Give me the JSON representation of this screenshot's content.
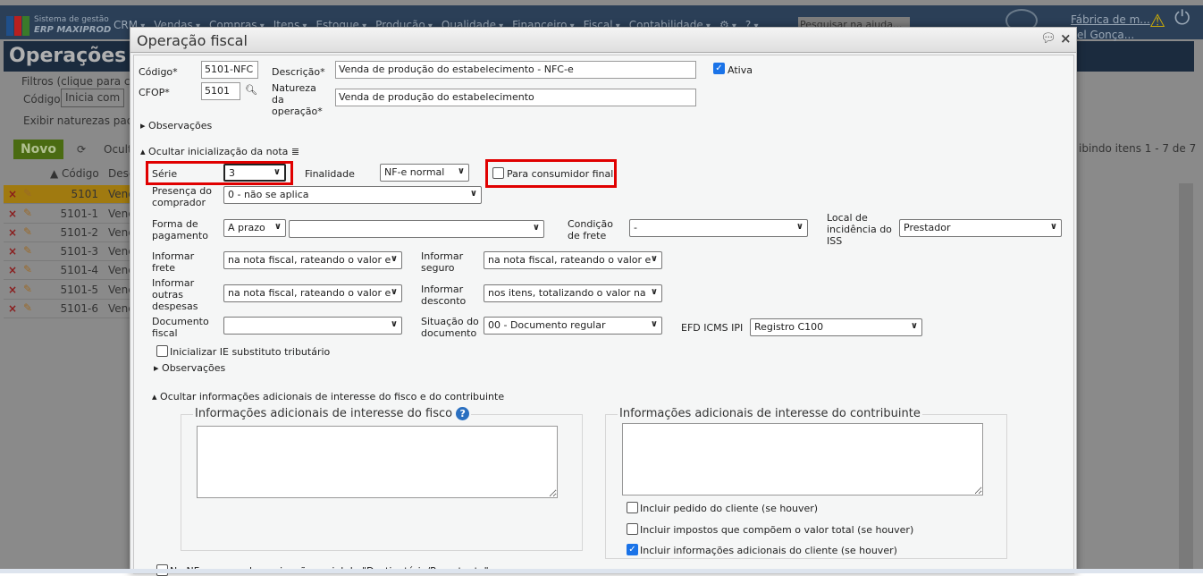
{
  "app": {
    "brand_line1": "Sistema de gestão",
    "brand_line2": "ERP MAXIPROD",
    "search_placeholder": "Pesquisar na ajuda...",
    "company": "Fábrica de m...",
    "user": "el Gonça...",
    "menu": [
      "CRM",
      "Vendas",
      "Compras",
      "Itens",
      "Estoque",
      "Produção",
      "Qualidade",
      "Financeiro",
      "Fiscal",
      "Contabilidade"
    ]
  },
  "background": {
    "page_title": "Operações f",
    "filters_label": "Filtros (clique para cor",
    "filter_field": "Código",
    "filter_op": "Inicia com",
    "show_label": "Exibir naturezas padrã",
    "new_button": "Novo",
    "hide_label": "Ocult",
    "paging": "ibindo itens 1 - 7 de 7",
    "col_code": "Código",
    "col_desc": "Desc",
    "rows": [
      {
        "code": "5101",
        "desc": "Venc"
      },
      {
        "code": "5101-1",
        "desc": "Venc"
      },
      {
        "code": "5101-2",
        "desc": "Venc"
      },
      {
        "code": "5101-3",
        "desc": "Venc"
      },
      {
        "code": "5101-4",
        "desc": "Venc"
      },
      {
        "code": "5101-5",
        "desc": "Venc"
      },
      {
        "code": "5101-6",
        "desc": "Venc"
      }
    ]
  },
  "modal": {
    "title": "Operação fiscal",
    "codigo_label": "Código*",
    "codigo": "5101-NFC",
    "descricao_label": "Descrição*",
    "descricao": "Venda de produção do estabelecimento - NFC-e",
    "ativa_label": "Ativa",
    "cfop_label": "CFOP*",
    "cfop": "5101",
    "natureza_label": "Natureza da operação*",
    "natureza": "Venda de produção do estabelecimento",
    "observacoes": "Observações",
    "ocultar_init": "Ocultar inicialização da nota",
    "serie_label": "Série",
    "serie": "3",
    "finalidade_label": "Finalidade",
    "finalidade": "NF-e normal",
    "consumidor_label": "Para consumidor final",
    "presenca_label": "Presença do comprador",
    "presenca": "0 - não se aplica",
    "forma_label": "Forma de pagamento",
    "forma": "A prazo",
    "forma2": "",
    "condicao_label": "Condição de frete",
    "condicao": "-",
    "local_iss_label": "Local de incidência do ISS",
    "local_iss": "Prestador",
    "frete_label": "Informar frete",
    "frete": "na nota fiscal, rateando o valor e",
    "seguro_label": "Informar seguro",
    "seguro": "na nota fiscal, rateando o valor e",
    "despesas_label": "Informar outras despesas",
    "despesas": "na nota fiscal, rateando o valor e",
    "desconto_label": "Informar desconto",
    "desconto": "nos itens, totalizando o valor na",
    "documento_label": "Documento fiscal",
    "documento": "",
    "situacao_label": "Situação do documento",
    "situacao": "00 - Documento regular",
    "efd_label": "EFD ICMS IPI",
    "efd": "Registro C100",
    "ie_label": "Inicializar IE substituto tributário",
    "observacoes2": "Observações",
    "ocultar_info": "Ocultar informações adicionais de interesse do fisco e do contribuinte",
    "fisco_legend": "Informações adicionais de interesse do fisco",
    "contrib_legend": "Informações adicionais de interesse do contribuinte",
    "incl_pedido": "Incluir pedido do cliente (se houver)",
    "incl_impostos": "Incluir impostos que compõem o valor total (se houver)",
    "incl_info": "Incluir informações adicionais do cliente (se houver)",
    "bottom_cb": "Na NF-e usar a denominação social do \"Destinatário/Remetente\""
  }
}
